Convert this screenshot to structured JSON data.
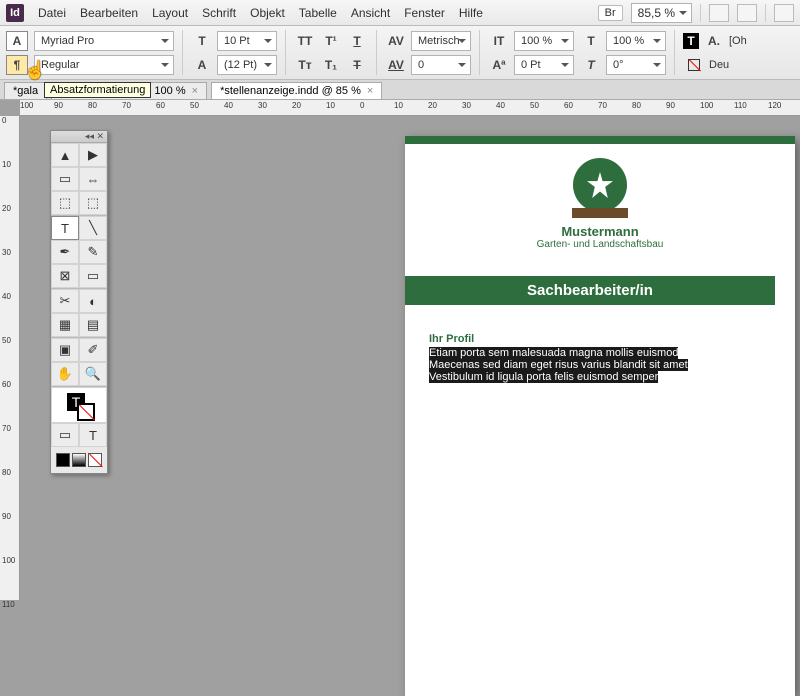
{
  "menu": {
    "items": [
      "Datei",
      "Bearbeiten",
      "Layout",
      "Schrift",
      "Objekt",
      "Tabelle",
      "Ansicht",
      "Fenster",
      "Hilfe"
    ],
    "logo": "Id",
    "br": "Br",
    "zoom": "85,5 %"
  },
  "ctrl": {
    "font": "Myriad Pro",
    "style": "Regular",
    "size": "10 Pt",
    "leading": "(12 Pt)",
    "kerning": "Metrisch",
    "tracking": "0",
    "vscale": "100 %",
    "hscale": "100 %",
    "baseline": "0 Pt",
    "skew": "0°",
    "lang": "Deu",
    "oh": "[Oh"
  },
  "tabs": [
    {
      "label": "*gala",
      "active": false
    },
    {
      "label": "lenanzeige.indd @ 100 %",
      "active": false,
      "close": "×"
    },
    {
      "label": "*stellenanzeige.indd @ 85 %",
      "active": true,
      "close": "×"
    }
  ],
  "tooltip": "Absatzformatierung",
  "ruler_h": [
    "100",
    "90",
    "80",
    "70",
    "60",
    "50",
    "40",
    "30",
    "20",
    "10",
    "0",
    "10",
    "20",
    "30",
    "40",
    "50",
    "60",
    "70",
    "80",
    "90",
    "100",
    "110",
    "120"
  ],
  "ruler_v": [
    "0",
    "10",
    "20",
    "30",
    "40",
    "50",
    "60",
    "70",
    "80",
    "90",
    "100",
    "110"
  ],
  "doc": {
    "company": "Mustermann",
    "tagline": "Garten- und Landschaftsbau",
    "title": "Sachbearbeiter/in",
    "profile_h": "Ihr Profil",
    "lines": [
      "Etiam porta sem malesuada magna mollis euismod",
      "Maecenas sed diam eget risus varius blandit sit amet",
      "Vestibulum id ligula porta felis euismod semper"
    ]
  }
}
